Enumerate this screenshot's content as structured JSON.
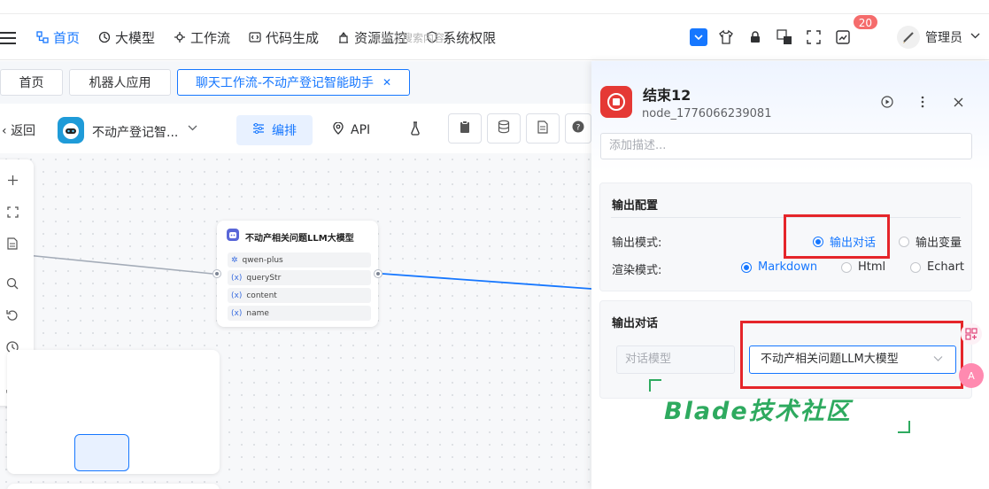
{
  "header": {
    "nav": [
      {
        "label": "首页",
        "icon": "home-icon",
        "active": true
      },
      {
        "label": "大模型",
        "icon": "model-icon",
        "active": false
      },
      {
        "label": "工作流",
        "icon": "workflow-icon",
        "active": false
      },
      {
        "label": "代码生成",
        "icon": "code-icon",
        "active": false
      },
      {
        "label": "资源监控",
        "icon": "monitor-icon",
        "active": false
      },
      {
        "label": "系统权限",
        "icon": "shield-icon",
        "active": false
      }
    ],
    "search_placeholder": "请输入搜索内容",
    "notification_count": "20",
    "user_name": "管理员"
  },
  "tabs": [
    {
      "label": "首页"
    },
    {
      "label": "机器人应用"
    },
    {
      "label": "聊天工作流-不动产登记智能助手",
      "close": "✕"
    }
  ],
  "toolbar": {
    "back_label": "返回",
    "app_name": "不动产登记智...",
    "mode_edit": "编排",
    "mode_api": "API"
  },
  "llm_node": {
    "title": "不动产相关问题LLM大模型",
    "rows": [
      {
        "icon": "model-icon",
        "label": "qwen-plus"
      },
      {
        "icon": "variable-icon",
        "label": "queryStr"
      },
      {
        "icon": "variable-icon",
        "label": "content"
      },
      {
        "icon": "variable-icon",
        "label": "name"
      }
    ]
  },
  "panel": {
    "title": "结束12",
    "node_id": "node_1776066239081",
    "description_placeholder": "添加描述...",
    "output_config": {
      "section_title": "输出配置",
      "output_mode_label": "输出模式:",
      "output_mode_options": [
        "输出对话",
        "输出变量"
      ],
      "output_mode_selected": "输出对话",
      "render_mode_label": "渲染模式:",
      "render_mode_options": [
        "Markdown",
        "Html",
        "Echart"
      ],
      "render_mode_selected": "Markdown"
    },
    "output_dialog": {
      "section_title": "输出对话",
      "model_label": "对话模型",
      "model_selected": "不动产相关问题LLM大模型"
    }
  },
  "watermark": "Blade技术社区",
  "colors": {
    "accent": "#1677ff",
    "danger": "#e5252a",
    "watermark": "#2eaa5f"
  }
}
